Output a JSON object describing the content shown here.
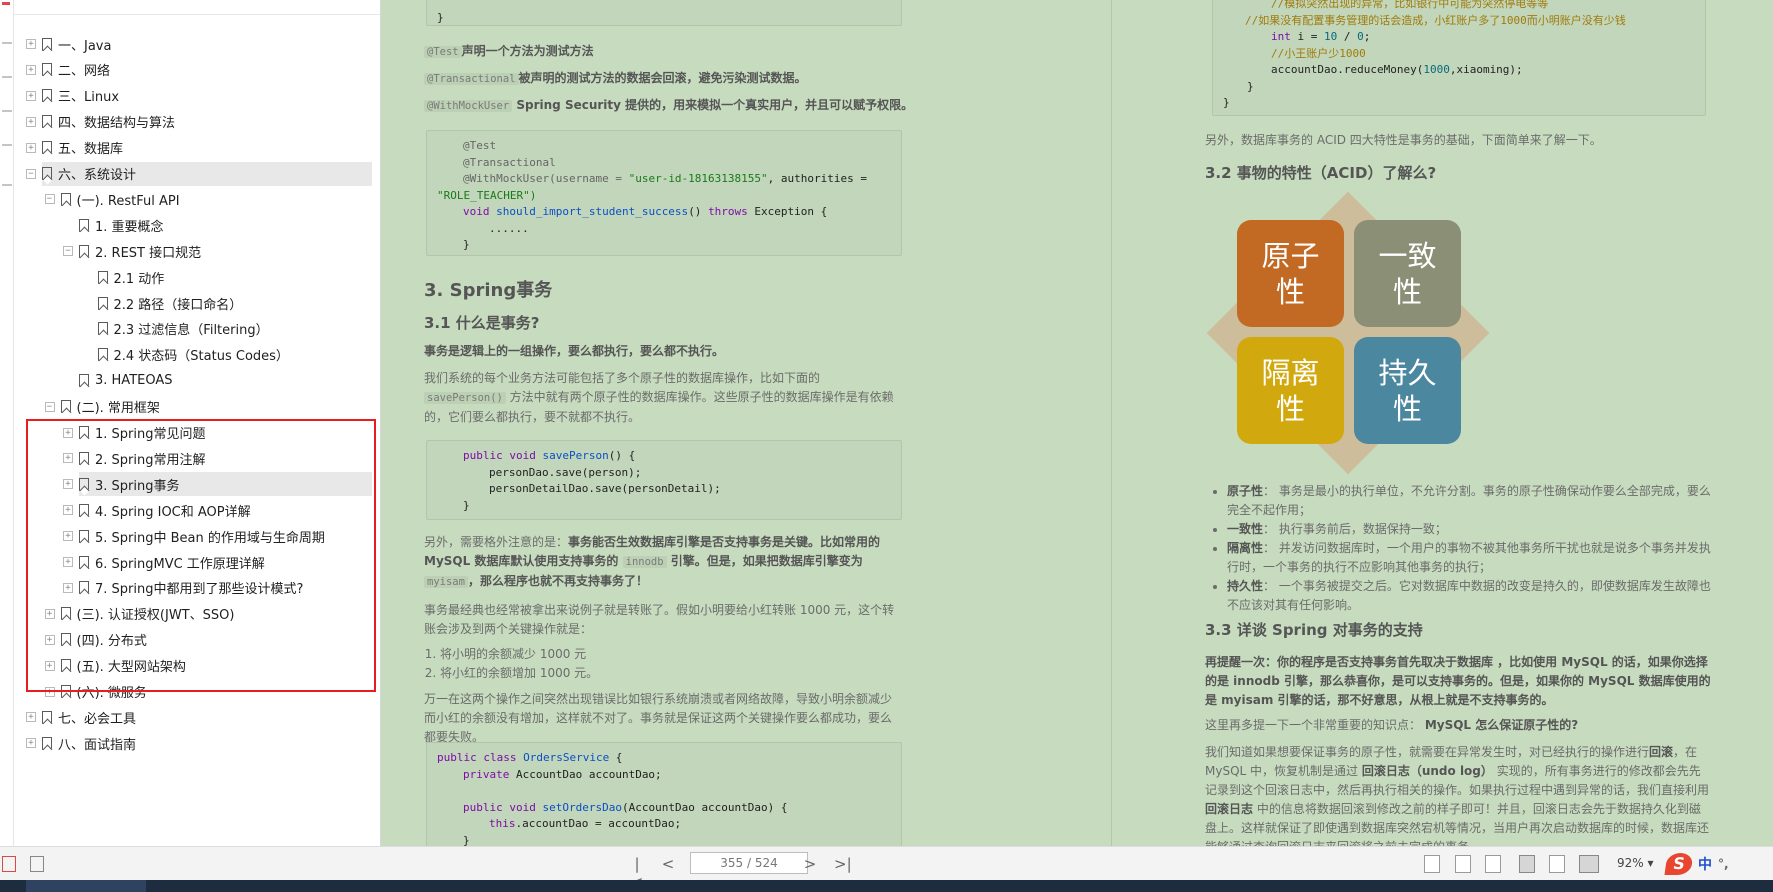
{
  "outline": {
    "items": [
      {
        "label": "一、Java"
      },
      {
        "label": "二、网络"
      },
      {
        "label": "三、Linux"
      },
      {
        "label": "四、数据结构与算法"
      },
      {
        "label": "五、数据库"
      },
      {
        "label": "六、系统设计"
      },
      {
        "label": "(一). RestFul API"
      },
      {
        "label": "1. 重要概念"
      },
      {
        "label": "2. REST 接口规范"
      },
      {
        "label": "2.1 动作"
      },
      {
        "label": "2.2 路径（接口命名）"
      },
      {
        "label": "2.3 过滤信息（Filtering）"
      },
      {
        "label": "2.4 状态码（Status Codes）"
      },
      {
        "label": "3. HATEOAS"
      },
      {
        "label": "(二). 常用框架"
      },
      {
        "label": "1. Spring常见问题"
      },
      {
        "label": "2. Spring常用注解"
      },
      {
        "label": "3. Spring事务"
      },
      {
        "label": "4. Spring IOC和 AOP详解"
      },
      {
        "label": "5. Spring中 Bean 的作用域与生命周期"
      },
      {
        "label": "6. SpringMVC 工作原理详解"
      },
      {
        "label": "7. Spring中都用到了那些设计模式?"
      },
      {
        "label": "(三). 认证授权(JWT、SSO)"
      },
      {
        "label": "(四). 分布式"
      },
      {
        "label": "(五). 大型网站架构"
      },
      {
        "label": "(六). 微服务"
      },
      {
        "label": "七、必会工具"
      },
      {
        "label": "八、面试指南"
      }
    ]
  },
  "doc_left": {
    "closing_brace": "}",
    "ann1_code": "@Test",
    "ann1_text": "声明一个方法为测试方法",
    "ann2_code": "@Transactional",
    "ann2_text": "被声明的测试方法的数据会回滚，避免污染测试数据。",
    "ann3_code": "@WithMockUser",
    "ann3_text": " Spring Security 提供的，用来模拟一个真实用户，并且可以赋予权限。",
    "code1": {
      "l1": "@Test",
      "l2": "@Transactional",
      "l3_a": "@WithMockUser(username = ",
      "l3_s1": "\"user-id-18163138155\"",
      "l3_b": ", authorities =",
      "l4": "\"ROLE_TEACHER\")",
      "l5_kw": "void ",
      "l5_fn": "should_import_student_success",
      "l5_b": "() ",
      "l5_kw2": "throws",
      "l5_c": " Exception {",
      "l6": "......",
      "l7": "}"
    },
    "h2": "3. Spring事务",
    "h3": "3.1 什么是事务?",
    "p1": "事务是逻辑上的一组操作，要么都执行，要么都不执行。",
    "p2_a": "我们系统的每个业务方法可能包括了多个原子性的数据库操作，比如下面的 ",
    "p2_code": "savePerson()",
    "p2_b": " 方法中就有两个原子性的数据库操作。这些原子性的数据库操作是有依赖的，它们要么都执行，要不就都不执行。",
    "code2": {
      "l1_kw": "public void ",
      "l1_fn": "savePerson",
      "l1_b": "() {",
      "l2": "personDao.save(person);",
      "l3": "personDetailDao.save(personDetail);",
      "l4": "}"
    },
    "p3_a": "另外，需要格外注意的是：",
    "p3_b": "事务能否生效数据库引擎是否支持事务是关键。比如常用的 MySQL 数据库默认使用支持事务的 ",
    "p3_code1": "innodb",
    "p3_c": " 引擎。但是，如果把数据库引擎变为 ",
    "p3_code2": "myisam",
    "p3_d": "，那么程序也就不再支持事务了！",
    "p4": "事务最经典也经常被拿出来说例子就是转账了。假如小明要给小红转账 1000 元，这个转账会涉及到两个关键操作就是：",
    "li1": "将小明的余额减少 1000 元",
    "li2": "将小红的余额增加 1000 元。",
    "p5": "万一在这两个操作之间突然出现错误比如银行系统崩溃或者网络故障，导致小明余额减少而小红的余额没有增加，这样就不对了。事务就是保证这两个关键操作要么都成功，要么都要失败。",
    "code3": {
      "l1_kw": "public class ",
      "l1_fn": "OrdersService",
      "l1_b": " {",
      "l2_kw": "private ",
      "l2_b": "AccountDao accountDao;",
      "l3_kw": "public void ",
      "l3_fn": "setOrdersDao",
      "l3_b": "(AccountDao accountDao) {",
      "l4_kw": "this",
      "l4_b": ".accountDao = accountDao;",
      "l5": "}"
    }
  },
  "doc_right": {
    "code_top": {
      "c1": "//模拟突然出现的异常，比如银行中可能为突然停电等等",
      "c2": "//如果没有配置事务管理的话会造成，小红账户多了1000而小明账户没有少钱",
      "l3_kw": "int ",
      "l3_b": "i = ",
      "l3_n1": "10",
      "l3_c": " / ",
      "l3_n2": "0",
      "l3_d": ";",
      "c4": "//小王账户少1000",
      "l5_a": "accountDao.reduceMoney(",
      "l5_n": "1000",
      "l5_b": ",xiaoming);",
      "l6": "}",
      "l7": "}"
    },
    "p1": "另外，数据库事务的 ACID 四大特性是事务的基础，下面简单来了解一下。",
    "h3a": "3.2 事物的特性（ACID）了解么?",
    "acid": {
      "q1": "原子性",
      "q2": "一致性",
      "q3": "隔离性",
      "q4": "持久性",
      "colors": {
        "atomic": "#c26a24",
        "consistent": "#8b8f76",
        "isolated": "#d1a90e",
        "durable": "#4b88a0"
      }
    },
    "b1_term": "原子性",
    "b1_text": "： 事务是最小的执行单位，不允许分割。事务的原子性确保动作要么全部完成，要么完全不起作用；",
    "b2_term": "一致性",
    "b2_text": "： 执行事务前后，数据保持一致；",
    "b3_term": "隔离性",
    "b3_text": "： 并发访问数据库时，一个用户的事物不被其他事务所干扰也就是说多个事务并发执行时，一个事务的执行不应影响其他事务的执行；",
    "b4_term": "持久性",
    "b4_text": "： 一个事务被提交之后。它对数据库中数据的改变是持久的，即使数据库发生故障也不应该对其有任何影响。",
    "h3b": "3.3 详谈 Spring 对事务的支持",
    "p2": "再提醒一次：你的程序是否支持事务首先取决于数据库 ，比如使用 MySQL 的话，如果你选择的是 innodb 引擎，那么恭喜你，是可以支持事务的。但是，如果你的 MySQL 数据库使用的是 myisam 引擎的话，那不好意思，从根上就是不支持事务的。",
    "p3_a": "这里再多提一下一个非常重要的知识点： ",
    "p3_b": "MySQL 怎么保证原子性的?",
    "p4_a": "我们知道如果想要保证事务的原子性，就需要在异常发生时，对已经执行的操作进行",
    "p4_b1": "回滚",
    "p4_c": "，在 MySQL 中，恢复机制是通过 ",
    "p4_b2": "回滚日志（undo log）",
    "p4_d": " 实现的，所有事务进行的修改都会先先记录到这个回滚日志中，然后再执行相关的操作。如果执行过程中遇到异常的话，我们直接利用 ",
    "p4_b3": "回滚日志",
    "p4_e": " 中的信息将数据回滚到修改之前的样子即可！并且，回滚日志会先于数据持久化到磁盘上。这样就保证了即使遇到数据库突然宕机等情况，当用户再次启动数据库的时候，数据库还能够通过查询回滚日志来回滚将之前未完成的事务。"
  },
  "toolbar": {
    "page": "355 / 524",
    "zoom": "92%",
    "ime": "中"
  }
}
